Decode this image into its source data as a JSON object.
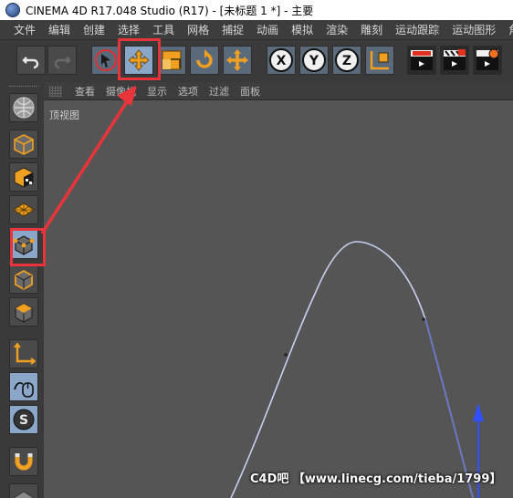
{
  "window": {
    "title": "CINEMA 4D R17.048 Studio (R17) - [未标题 1 *] - 主要"
  },
  "menubar": {
    "items": [
      "文件",
      "编辑",
      "创建",
      "选择",
      "工具",
      "网格",
      "捕捉",
      "动画",
      "模拟",
      "渲染",
      "雕刻",
      "运动跟踪",
      "运动图形",
      "角色"
    ]
  },
  "toolbar": {
    "buttons": [
      "undo-icon",
      "redo-icon",
      "live-select-icon",
      "move-icon",
      "scale-icon",
      "rotate-icon",
      "recent-tool-icon",
      "x-axis-icon",
      "y-axis-icon",
      "z-axis-icon",
      "coordinate-system-icon",
      "render-view-icon",
      "render-to-picture-viewer-icon",
      "render-settings-icon"
    ],
    "axis_labels": {
      "x": "X",
      "y": "Y",
      "z": "Z"
    }
  },
  "viewport": {
    "menu": [
      "查看",
      "摄像机",
      "显示",
      "选项",
      "过滤",
      "面板"
    ],
    "label": "顶视图",
    "watermark": "C4D吧 【www.linecg.com/tieba/1799】"
  },
  "colors": {
    "highlight": "#e8343a",
    "accent_orange": "#f0a020",
    "active_blue": "#8aa6c8",
    "spline": "#c8d0f0",
    "y_axis": "#3050ff"
  }
}
